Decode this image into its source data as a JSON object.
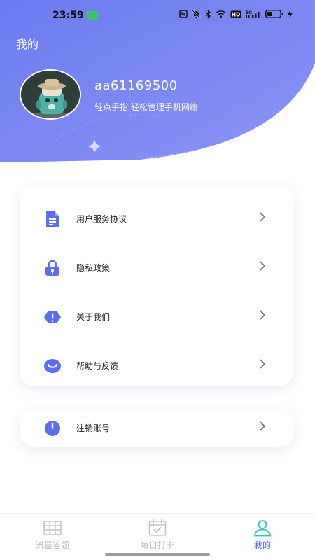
{
  "status_bar": {
    "time": "23:59",
    "icons": [
      "nfc-icon",
      "mute-icon",
      "bluetooth-icon",
      "wifi-icon",
      "hd-icon",
      "signal-icon",
      "battery-icon",
      "charging-icon"
    ],
    "hd_text": "HD",
    "network_text": "5G"
  },
  "header": {
    "title": "我的",
    "gradient_start": "#6c7df2",
    "gradient_end": "#8e95f6"
  },
  "profile": {
    "username": "aa61169500",
    "slogan": "轻点手指 轻松管理手机网络"
  },
  "menu": {
    "items": [
      {
        "label": "用户服务协议",
        "icon": "document-icon"
      },
      {
        "label": "隐私政策",
        "icon": "lock-icon"
      },
      {
        "label": "关于我们",
        "icon": "info-icon"
      },
      {
        "label": "帮助与反馈",
        "icon": "smile-icon"
      }
    ],
    "cancel": {
      "label": "注销账号",
      "icon": "power-icon"
    }
  },
  "tabbar": {
    "tabs": [
      {
        "label": "流量答题",
        "icon": "grid-icon",
        "active": false
      },
      {
        "label": "每日打卡",
        "icon": "calendar-icon",
        "active": false
      },
      {
        "label": "我的",
        "icon": "user-icon",
        "active": true
      }
    ]
  },
  "colors": {
    "accent": "#4b5fe6",
    "icon": "#5e6df0",
    "tab_active_icon": "#2ec4b6"
  }
}
